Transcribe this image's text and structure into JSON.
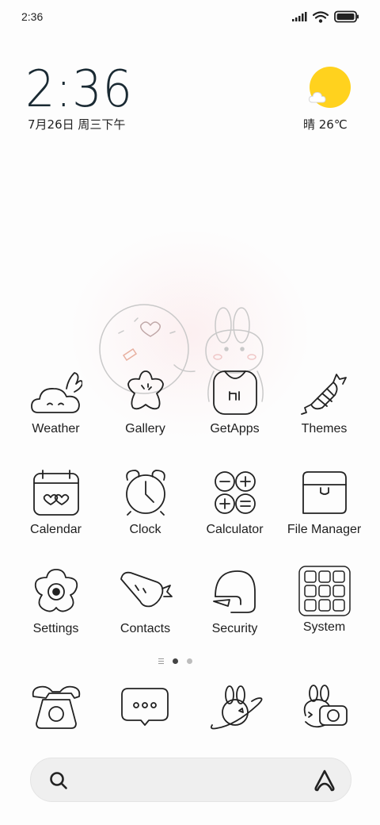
{
  "status_bar": {
    "time": "2:36",
    "icons": [
      "signal-icon",
      "wifi-icon",
      "battery-icon"
    ]
  },
  "clock_widget": {
    "time": "2:36",
    "date": "7月26日 周三下午"
  },
  "weather_widget": {
    "condition_icon": "sun-cloud-icon",
    "text": "晴 26℃"
  },
  "apps": [
    {
      "label": "Weather",
      "icon": "weather-bunny-cloud-icon"
    },
    {
      "label": "Gallery",
      "icon": "gallery-star-icon"
    },
    {
      "label": "GetApps",
      "icon": "getapps-bag-icon"
    },
    {
      "label": "Themes",
      "icon": "themes-candy-icon"
    },
    {
      "label": "Calendar",
      "icon": "calendar-icon"
    },
    {
      "label": "Clock",
      "icon": "alarm-clock-icon"
    },
    {
      "label": "Calculator",
      "icon": "calculator-icon"
    },
    {
      "label": "File Manager",
      "icon": "folder-icon"
    },
    {
      "label": "Settings",
      "icon": "settings-egg-icon"
    },
    {
      "label": "Contacts",
      "icon": "contacts-carrot-icon"
    },
    {
      "label": "Security",
      "icon": "security-helmet-icon"
    },
    {
      "label": "System",
      "icon": "system-folder-icon"
    }
  ],
  "page_indicator": {
    "pages": 2,
    "active": 1
  },
  "dock": [
    {
      "icon": "phone-icon"
    },
    {
      "icon": "messaging-icon"
    },
    {
      "icon": "browser-bunny-planet-icon"
    },
    {
      "icon": "camera-bunny-icon"
    }
  ],
  "search_bar": {
    "left_icon": "search-icon",
    "right_icon": "assistant-icon"
  },
  "colors": {
    "sun": "#ffd21e",
    "line": "#222222",
    "background": "#fdfdfd"
  }
}
